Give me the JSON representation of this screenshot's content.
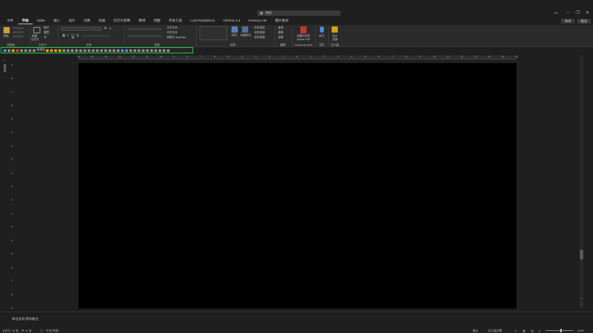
{
  "title_bar": {
    "search_placeholder": "搜索"
  },
  "tabs": [
    "文件",
    "开始",
    "iSlide",
    "插入",
    "设计",
    "切换",
    "动画",
    "幻灯片放映",
    "审阅",
    "视图",
    "开发工具",
    "LvyhTools(0514)",
    "OKPlus 4.3",
    "OneKey Lite",
    "图片格式"
  ],
  "active_tab": "开始",
  "share_label": "共享",
  "comments_label": "批注",
  "ribbon": {
    "groups": {
      "clipboard": "剪贴板",
      "slides": "幻灯片",
      "font": "字体",
      "paragraph": "段落",
      "drawing": "绘图",
      "editing": "编辑",
      "adobe": "Adobe Acrobat",
      "voice": "语音",
      "designer": "设计器"
    },
    "buttons": {
      "paste": "粘贴",
      "new_slide": "新建\n幻灯片",
      "layout": "版式",
      "reset": "重置",
      "section": "节",
      "shapes": "形状",
      "arrange": "排列",
      "quick_styles": "快速样式",
      "shape_fill": "形状填充",
      "shape_outline": "形状轮廓",
      "shape_effects": "形状效果",
      "find": "查找",
      "replace": "替换",
      "select": "选择",
      "create_pdf": "创建并共享\nAdobe PDF",
      "dictate": "听写",
      "design_ideas": "设计\n灵感",
      "text_direction": "文字方向",
      "align_text": "对齐文本",
      "convert_smartart": "转换为 SmartArt"
    }
  },
  "qat": {
    "label": "新等线"
  },
  "ruler": {
    "top_ticks": [
      "16",
      "15",
      "14",
      "13",
      "12",
      "11",
      "10",
      "9",
      "8",
      "7",
      "6",
      "5",
      "4",
      "3",
      "2",
      "1",
      "0",
      "1",
      "2",
      "3",
      "4",
      "5",
      "6",
      "7",
      "8",
      "9",
      "10",
      "11",
      "12",
      "13",
      "14",
      "15",
      "16"
    ],
    "left_ticks": [
      "9",
      "8",
      "7",
      "6",
      "5",
      "4",
      "3",
      "2",
      "1",
      "0",
      "1",
      "2",
      "3",
      "4",
      "5",
      "6",
      "7",
      "8",
      "9"
    ]
  },
  "notes": {
    "placeholder": "单击此处添加备注"
  },
  "status": {
    "slide_info": "幻灯片 16 张，共 16 张",
    "language": "中文(中国)",
    "notes_btn": "备注",
    "display_settings": "显示器设置",
    "zoom": "145%"
  },
  "side_panel_label": "缩略图"
}
